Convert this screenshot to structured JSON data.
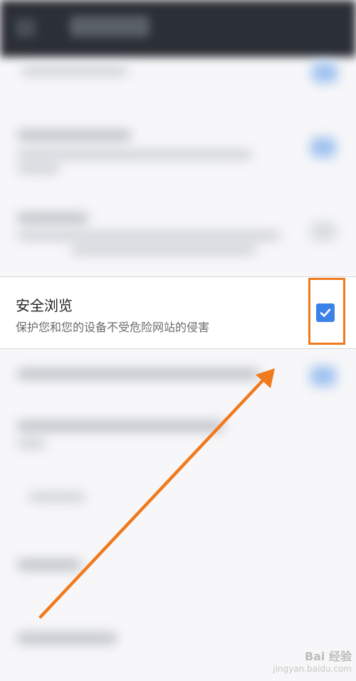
{
  "setting_row": {
    "title": "安全浏览",
    "subtitle": "保护您和您的设备不受危险网站的侵害",
    "checkbox_checked": true,
    "checkbox_icon": "checkmark-icon"
  },
  "annotation": {
    "highlight_color": "#f07a1e",
    "arrow_color": "#f07a1e"
  },
  "colors": {
    "accent": "#3b82e8",
    "topbar": "#2b2f36"
  },
  "watermark": {
    "brand": "Bai 经验",
    "url": "jingyan.baidu.com"
  }
}
